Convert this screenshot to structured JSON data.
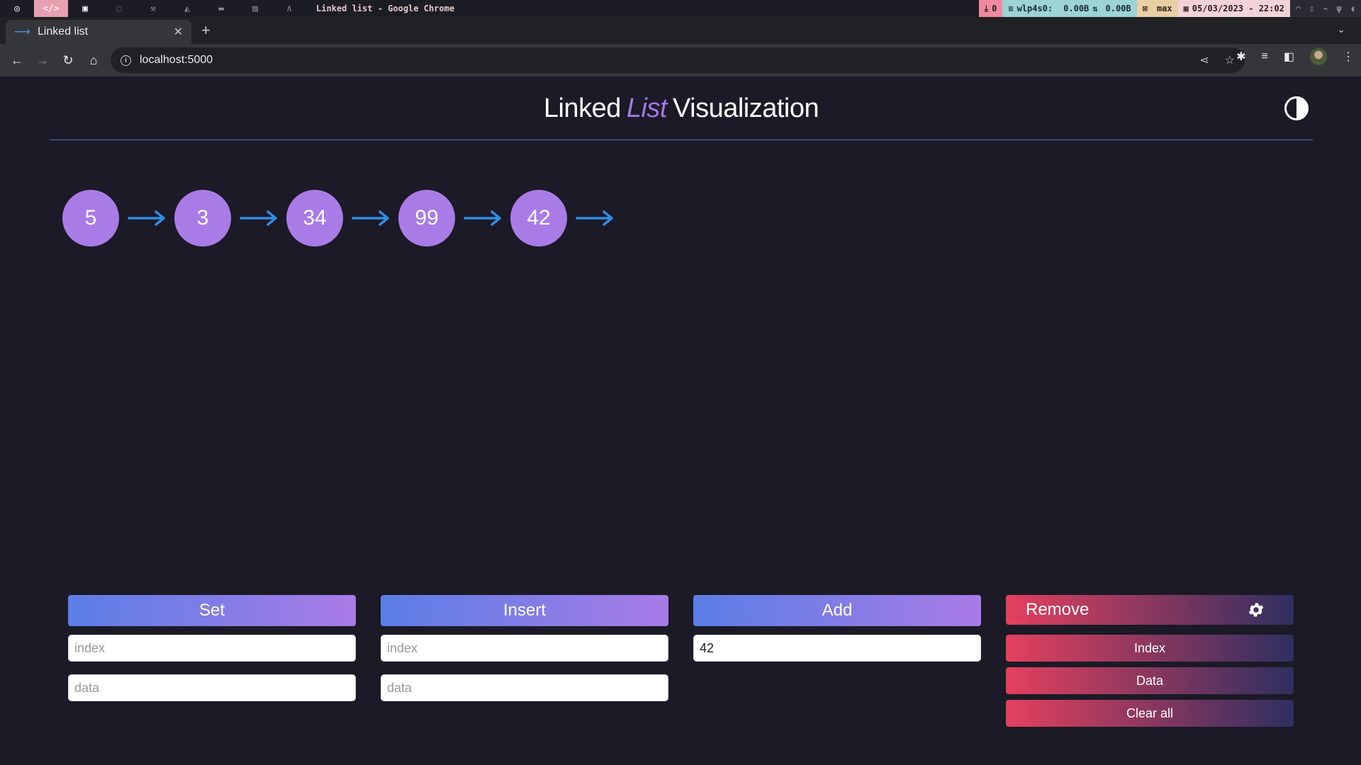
{
  "system_bar": {
    "window_title": "Linked list - Google Chrome",
    "downloads": "0",
    "network_iface": "wlp4s0:",
    "net_down": "0.00B",
    "net_up": "0.00B",
    "layout": "max",
    "datetime": "05/03/2023 - 22:02"
  },
  "browser": {
    "tab_title": "Linked list",
    "url": "localhost:5000"
  },
  "page": {
    "title_left": "Linked",
    "title_accent": "List",
    "title_right": "Visualization"
  },
  "linked_list": {
    "nodes": [
      "5",
      "3",
      "34",
      "99",
      "42"
    ]
  },
  "controls": {
    "set": {
      "label": "Set",
      "index_placeholder": "index",
      "data_placeholder": "data"
    },
    "insert": {
      "label": "Insert",
      "index_placeholder": "index",
      "data_placeholder": "data"
    },
    "add": {
      "label": "Add",
      "value": "42"
    },
    "remove": {
      "label": "Remove",
      "index_label": "Index",
      "data_label": "Data",
      "clear_label": "Clear all"
    }
  },
  "colors": {
    "background": "#1b1a26",
    "node": "#a97be6",
    "arrow": "#2f8be0",
    "accent_blue": "#5a7ee6",
    "remove_red": "#e5405e"
  }
}
